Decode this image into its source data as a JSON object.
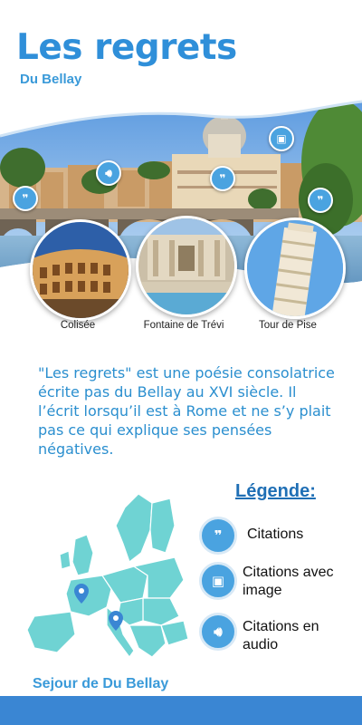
{
  "header": {
    "title": "Les regrets",
    "subtitle": "Du Bellay"
  },
  "places": [
    {
      "label": "Colisée"
    },
    {
      "label": "Fontaine de Trévi"
    },
    {
      "label": "Tour de Pise"
    }
  ],
  "description": "\"Les regrets\" est une poésie consolatrice écrite pas du Bellay au XVI siècle. Il l’écrit lorsqu’il est à Rome et ne s’y plait pas ce qui explique ses pensées négatives.",
  "legend": {
    "title": "Légende:",
    "items": [
      {
        "icon": "quote-icon",
        "label": "Citations"
      },
      {
        "icon": "image-icon",
        "label": "Citations avec image"
      },
      {
        "icon": "audio-icon",
        "label": "Citations en audio"
      }
    ]
  },
  "map": {
    "caption": "Sejour de Du Bellay"
  },
  "colors": {
    "accent": "#2f8fd9",
    "icon": "#4aa3e0",
    "footer": "#3a86d3"
  }
}
